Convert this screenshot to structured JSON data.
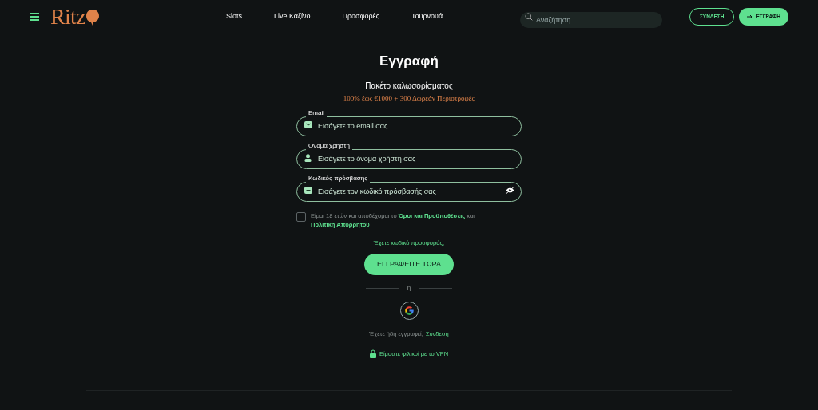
{
  "header": {
    "logo": "Ritz",
    "nav": [
      {
        "label": "Slots"
      },
      {
        "label": "Live Καζίνο"
      },
      {
        "label": "Προσφορές"
      },
      {
        "label": "Τουρνουά"
      }
    ],
    "search": {
      "placeholder": "Αναζήτηση"
    },
    "login_button": "ΣΥΝΔΕΣΗ",
    "register_button": "ΕΓΓΡΑΦΗ"
  },
  "form": {
    "title": "Εγγραφή",
    "subtitle": "Πακέτο καλωσορίσματος",
    "bonus": "100% έως €1000 + 300 Δωρεάν Περιστροφές",
    "fields": [
      {
        "kind": "email",
        "label": "Email",
        "placeholder": "Εισάγετε το email σας"
      },
      {
        "kind": "user",
        "label": "Όνομα χρήστη",
        "placeholder": "Εισάγετε το όνομα χρήστη σας"
      },
      {
        "kind": "password",
        "label": "Κωδικός πρόσβασης",
        "placeholder": "Εισάγετε τον κωδικό πρόσβασής σας"
      }
    ],
    "terms": {
      "checked": false,
      "text": "Είμαι 18 ετών και αποδέχομαι το",
      "terms_link": "Όροι και Προϋποθέσεις",
      "middle": "και",
      "privacy_link": "Πολιτική Απορρήτου"
    },
    "promo_link": "Έχετε κωδικό προσφοράς;",
    "submit": "ΕΓΓΡΑΦΕΙΤΕ ΤΩΡΑ",
    "separator": "ή",
    "already": "Έχετε ήδη εγγραφεί;",
    "login_link": "Σύνδεση",
    "vpn": "Είμαστε φιλικοί με το VPN"
  }
}
